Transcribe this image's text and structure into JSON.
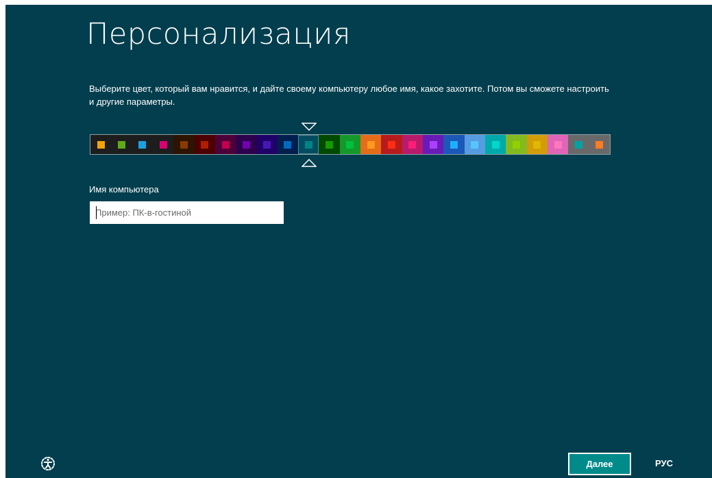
{
  "header": {
    "title": "Персонализация",
    "description": "Выберите цвет, который вам нравится, и дайте своему компьютеру любое имя, какое захотите. Потом вы сможете настроить и другие параметры."
  },
  "color_picker": {
    "selected_index": 10,
    "swatches": [
      {
        "bg": "#1d1d1d",
        "chip": "#f0a30a"
      },
      {
        "bg": "#1d1d1d",
        "chip": "#60a917"
      },
      {
        "bg": "#1d1d1d",
        "chip": "#1ba1e2"
      },
      {
        "bg": "#1d1d1d",
        "chip": "#d80073"
      },
      {
        "bg": "#2d1400",
        "chip": "#8b3a00"
      },
      {
        "bg": "#4e0000",
        "chip": "#b01e00"
      },
      {
        "bg": "#4e0038",
        "chip": "#c1004f"
      },
      {
        "bg": "#2d004e",
        "chip": "#7200ac"
      },
      {
        "bg": "#1f0068",
        "chip": "#4617b4"
      },
      {
        "bg": "#001e4e",
        "chip": "#006ac1"
      },
      {
        "bg": "#004d60",
        "chip": "#008287"
      },
      {
        "bg": "#004a00",
        "chip": "#199900"
      },
      {
        "bg": "#15992a",
        "chip": "#00c13f"
      },
      {
        "bg": "#e56c19",
        "chip": "#ff981d"
      },
      {
        "bg": "#b81b1b",
        "chip": "#ff2e12"
      },
      {
        "bg": "#b81b6c",
        "chip": "#ff1d77"
      },
      {
        "bg": "#691bb8",
        "chip": "#aa40ff"
      },
      {
        "bg": "#1b58b8",
        "chip": "#1faeff"
      },
      {
        "bg": "#569ce3",
        "chip": "#56c5ff"
      },
      {
        "bg": "#00aaaa",
        "chip": "#00d8cc"
      },
      {
        "bg": "#83ba1f",
        "chip": "#91d100"
      },
      {
        "bg": "#d39d09",
        "chip": "#e1b700"
      },
      {
        "bg": "#e064b7",
        "chip": "#ff76bc"
      },
      {
        "bg": "#696969",
        "chip": "#00a3a3"
      },
      {
        "bg": "#696969",
        "chip": "#fe7c22"
      }
    ]
  },
  "computer_name": {
    "label": "Имя компьютера",
    "placeholder": "Пример: ПК-в-гостиной",
    "value": ""
  },
  "footer": {
    "accessibility_icon": "ease-of-access-icon",
    "next_label": "Далее",
    "next_color": "#008b8b",
    "language_label": "РУС"
  },
  "colors": {
    "background": "#023e4d",
    "text": "#ffffff"
  }
}
